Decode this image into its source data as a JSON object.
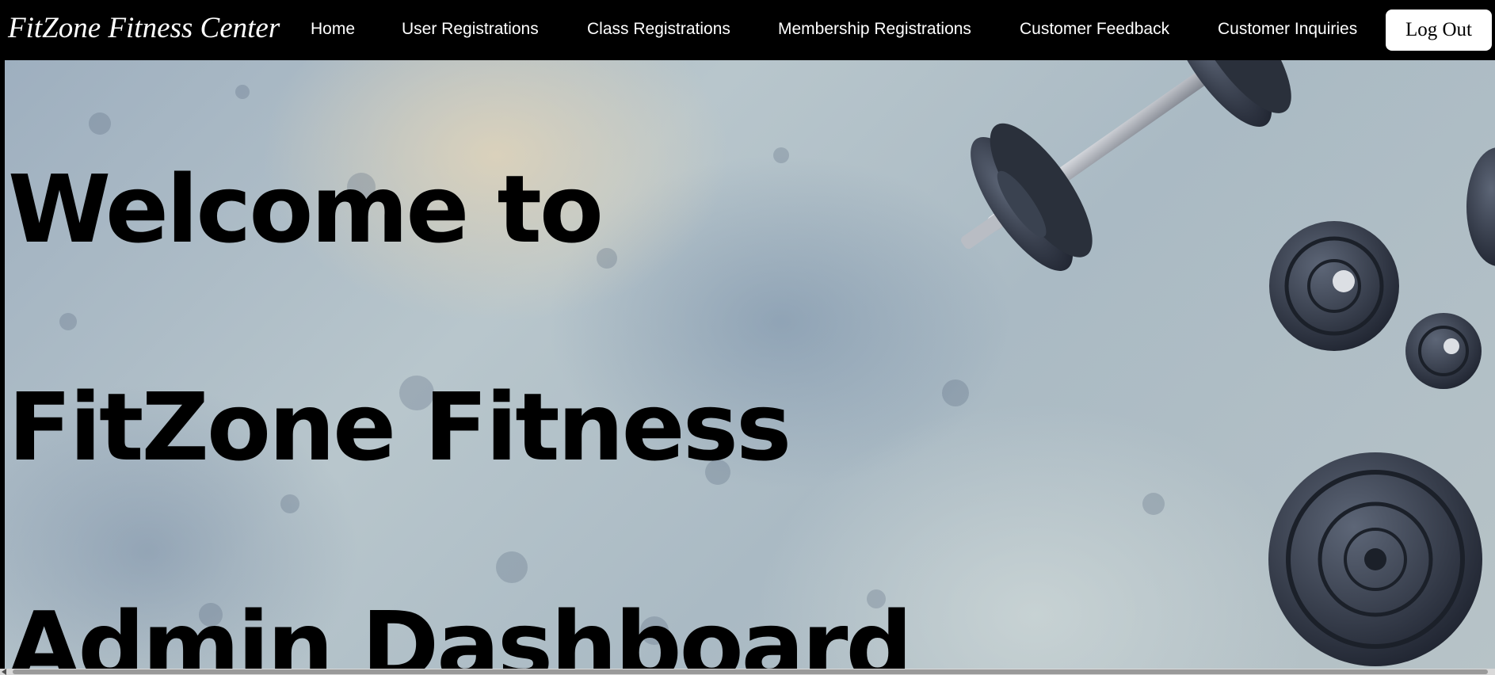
{
  "brand": "FitZone Fitness Center",
  "nav": {
    "home": "Home",
    "user_registrations": "User Registrations",
    "class_registrations": "Class Registrations",
    "membership_registrations": "Membership Registrations",
    "customer_feedback": "Customer Feedback",
    "customer_inquiries": "Customer Inquiries"
  },
  "logout_label": "Log Out",
  "hero": {
    "line1": "Welcome to",
    "line2": "FitZone Fitness",
    "line3": "Admin Dashboard"
  },
  "colors": {
    "navbar_bg": "#000000",
    "nav_text": "#ffffff",
    "logout_bg": "#ffffff",
    "heading_text": "#000000"
  },
  "icons": {
    "background_image": "dumbbell-weights-image"
  }
}
